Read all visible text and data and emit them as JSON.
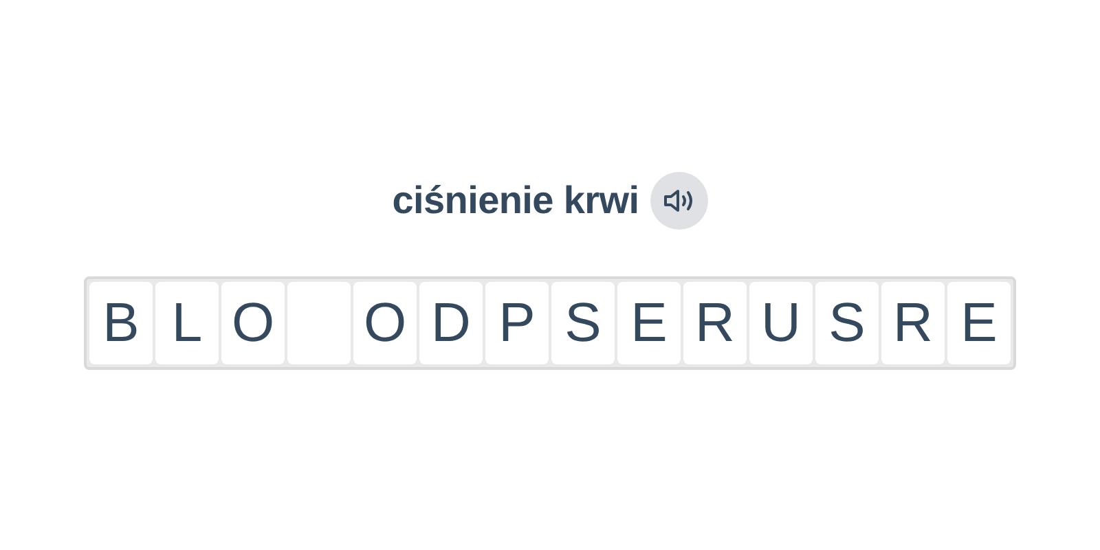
{
  "prompt": {
    "text": "ciśnienie krwi"
  },
  "tiles": [
    {
      "kind": "letter",
      "letter": "B"
    },
    {
      "kind": "letter",
      "letter": "L"
    },
    {
      "kind": "letter",
      "letter": "O"
    },
    {
      "kind": "blank"
    },
    {
      "kind": "letter",
      "letter": "O"
    },
    {
      "kind": "letter",
      "letter": "D"
    },
    {
      "kind": "letter",
      "letter": "P"
    },
    {
      "kind": "letter",
      "letter": "S"
    },
    {
      "kind": "letter",
      "letter": "E"
    },
    {
      "kind": "letter",
      "letter": "R"
    },
    {
      "kind": "letter",
      "letter": "U"
    },
    {
      "kind": "letter",
      "letter": "S"
    },
    {
      "kind": "letter",
      "letter": "R"
    },
    {
      "kind": "letter",
      "letter": "E"
    }
  ]
}
